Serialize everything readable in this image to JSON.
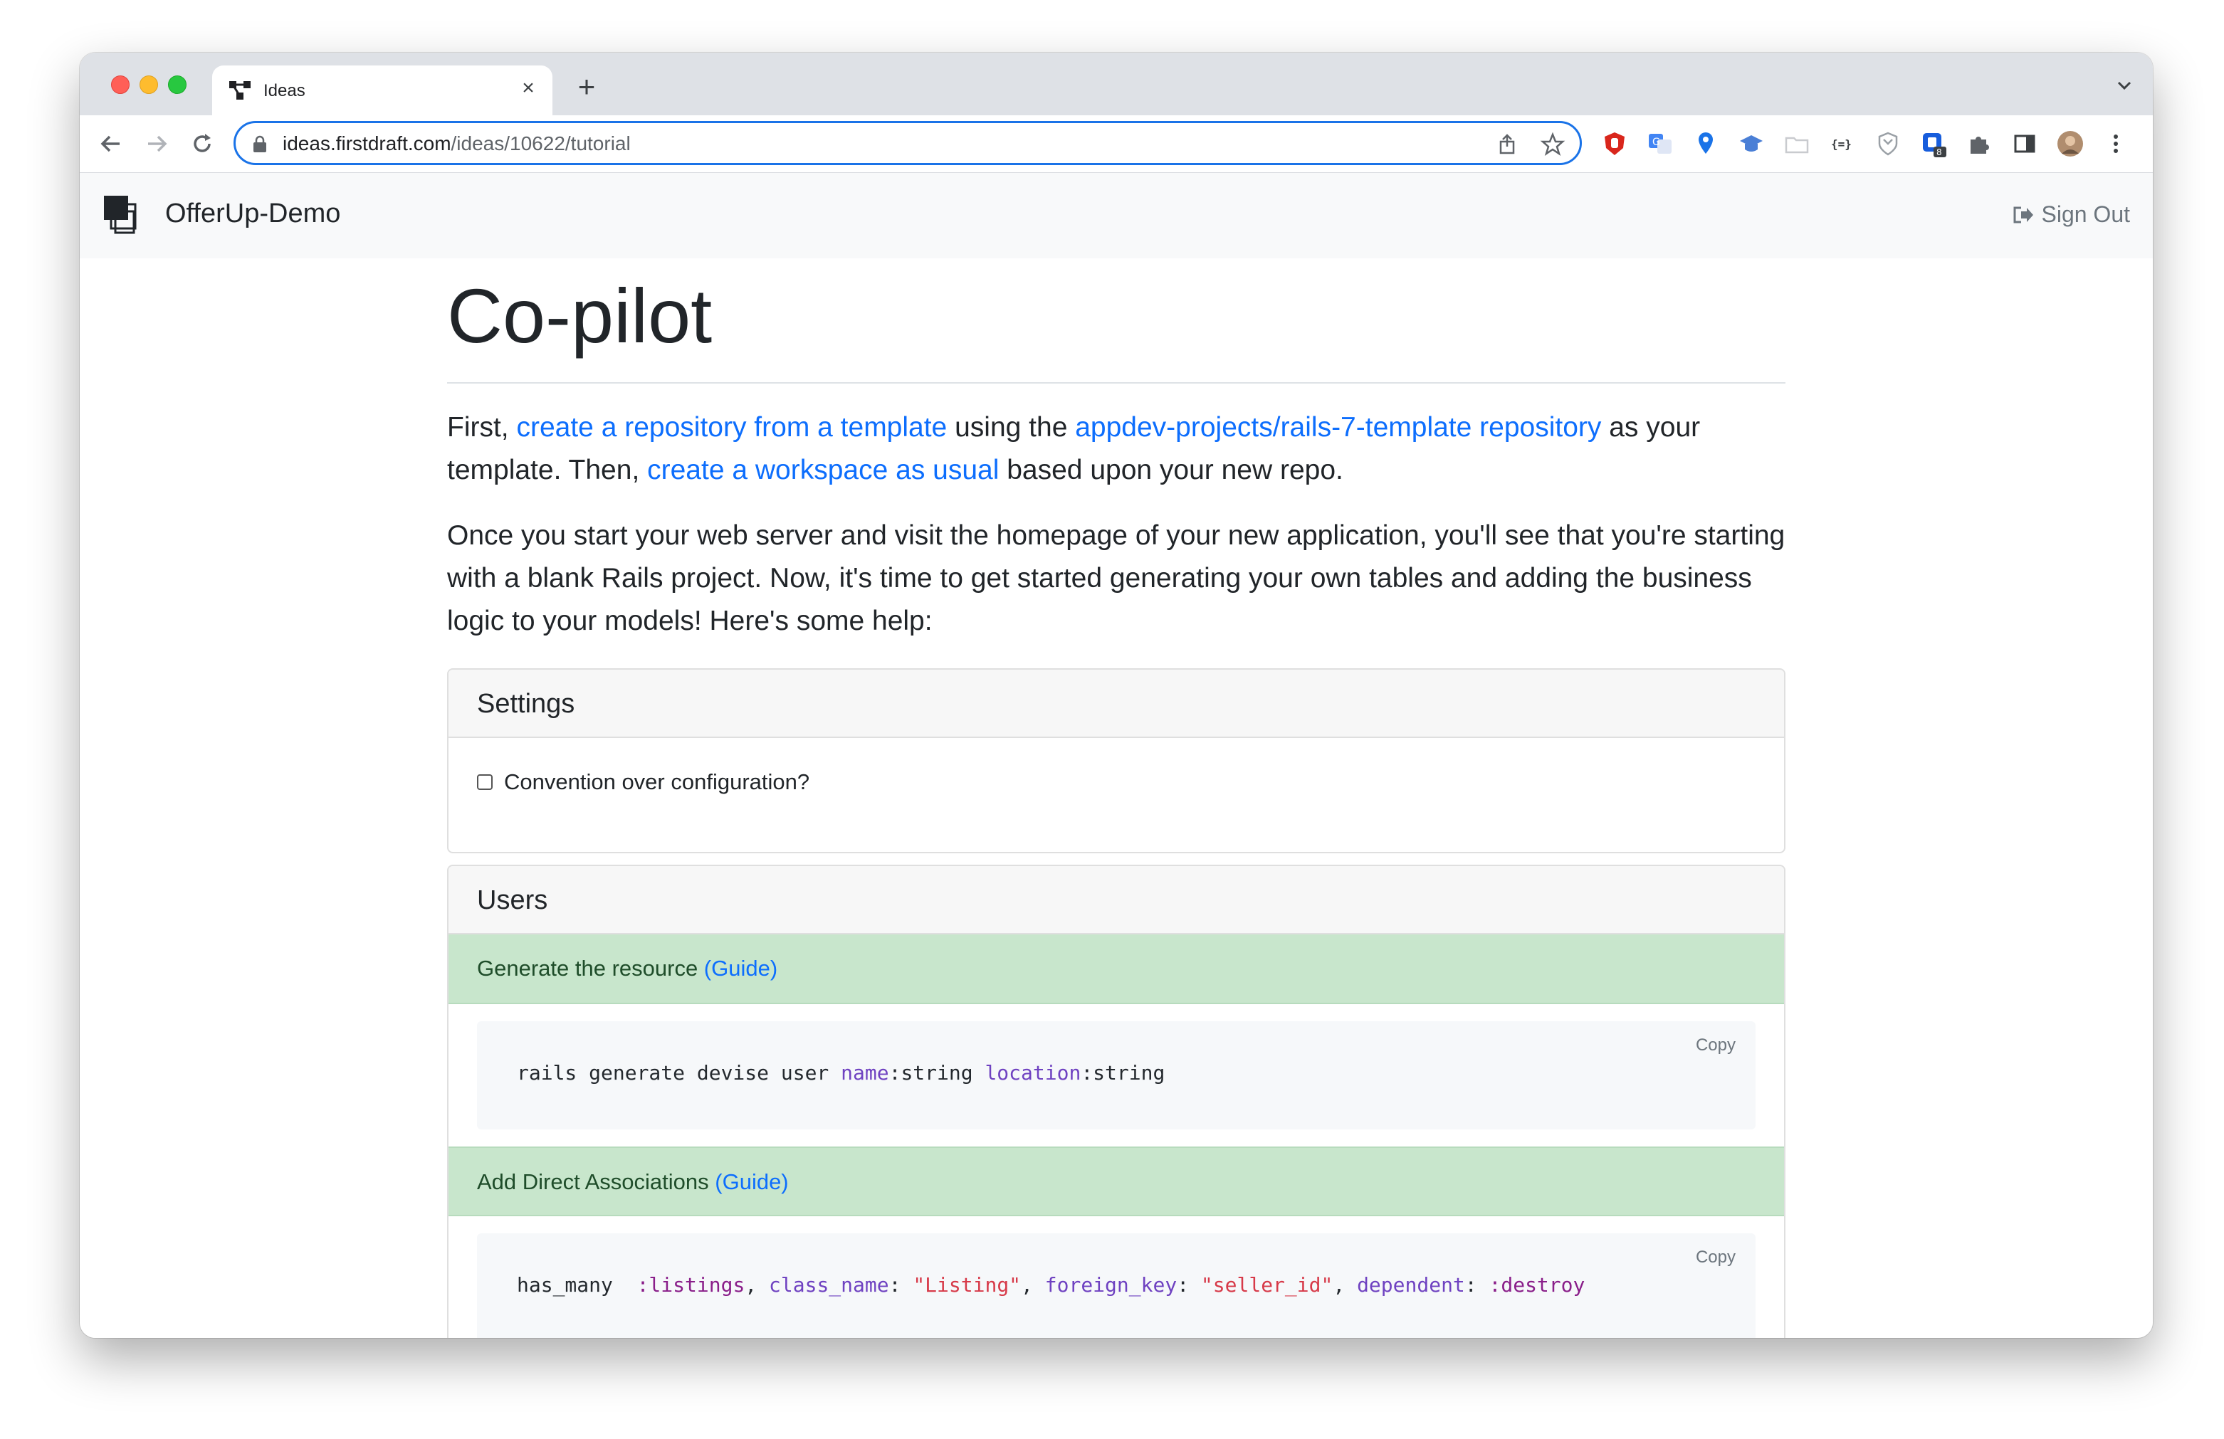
{
  "browser": {
    "tab_title": "Ideas",
    "new_tab_symbol": "+",
    "close_symbol": "×",
    "url_host": "ideas.firstdraft.com",
    "url_path": "/ideas/10622/tutorial",
    "extension_badge": "8"
  },
  "navbar": {
    "brand": "OfferUp-Demo",
    "sign_out": "Sign Out"
  },
  "main": {
    "title": "Co-pilot",
    "para1": {
      "t1": "First, ",
      "link1": "create a repository from a template",
      "t2": " using the ",
      "link2": "appdev-projects/rails-7-template repository",
      "t3": " as your template. Then, ",
      "link3": "create a workspace as usual",
      "t4": " based upon your new repo."
    },
    "para2": "Once you start your web server and visit the homepage of your new application, you'll see that you're starting with a blank Rails project. Now, it's time to get started generating your own tables and adding the business logic to your models! Here's some help:",
    "settings": {
      "header": "Settings",
      "checkbox_label": "Convention over configuration?",
      "checked": false
    },
    "users": {
      "header": "Users",
      "step1_label": "Generate the resource ",
      "step1_guide": "(Guide)",
      "code1": {
        "a": "rails generate devise user ",
        "b": "name",
        "c": ":string ",
        "d": "location",
        "e": ":string"
      },
      "copy_label": "Copy",
      "step2_label": "Add Direct Associations ",
      "step2_guide": "(Guide)",
      "code2": {
        "a": "has_many  ",
        "b": ":listings",
        "c": ", ",
        "d": "class_name",
        "e": ": ",
        "f": "\"Listing\"",
        "g": ", ",
        "h": "foreign_key",
        "i": ": ",
        "j": "\"seller_id\"",
        "k": ", ",
        "l": "dependent",
        "m": ": ",
        "n": ":destroy"
      }
    }
  }
}
